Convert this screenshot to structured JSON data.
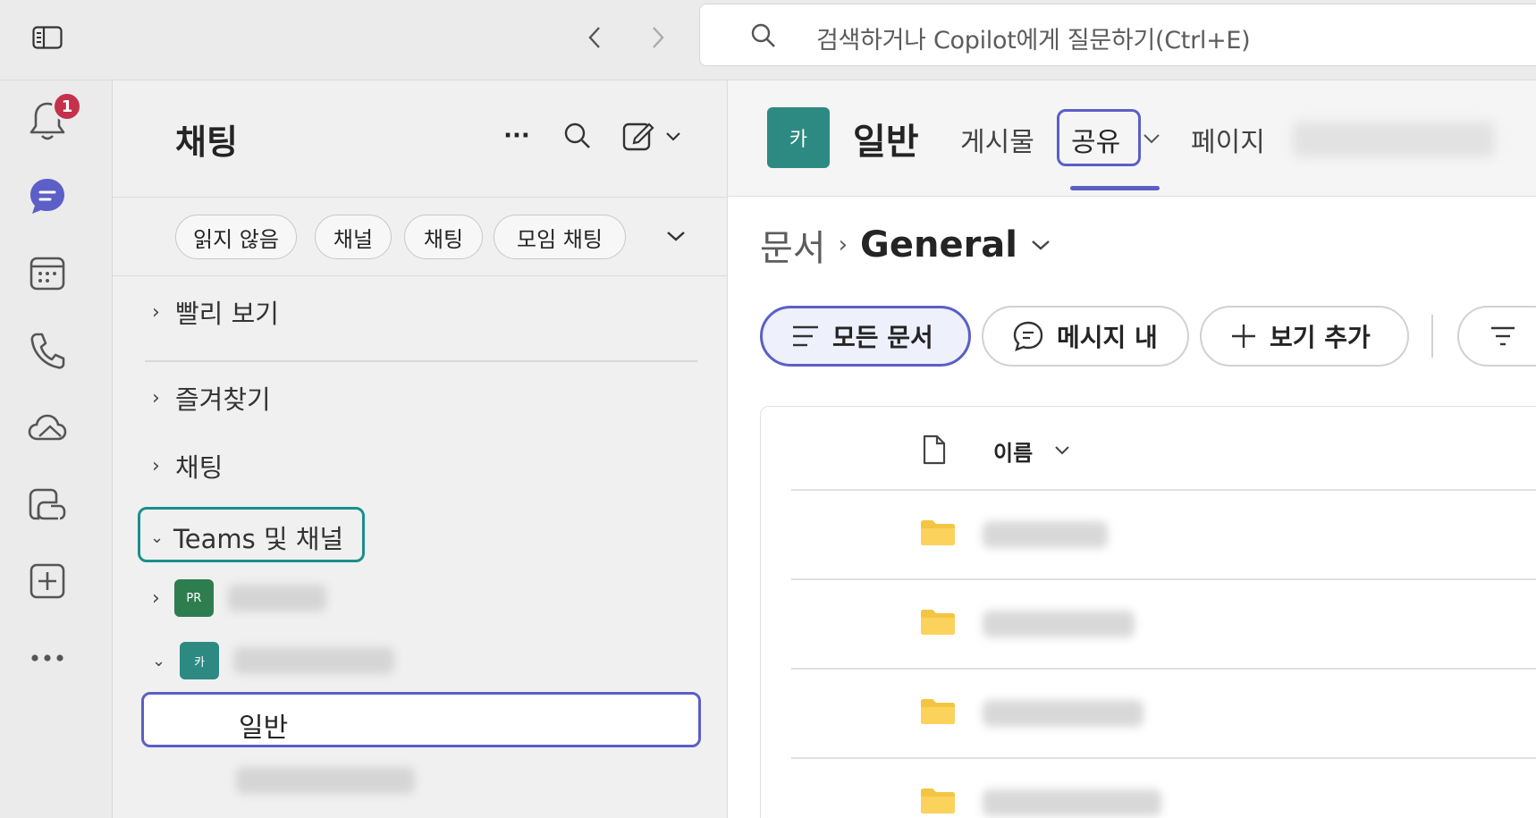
{
  "titlebar": {
    "search_placeholder": "검색하거나 Copilot에게 질문하기(Ctrl+E)"
  },
  "rail": {
    "notification_count": "1"
  },
  "chat_pane": {
    "title": "채팅",
    "more_label": "···",
    "filters": [
      "읽지 않음",
      "채널",
      "채팅",
      "모임 채팅"
    ],
    "sections": {
      "quick_view": "빨리 보기",
      "favorites": "즐겨찾기",
      "chats": "채팅",
      "teams": "Teams 및 채널"
    },
    "teams": [
      {
        "avatar": "PR",
        "color": "#2e7d4f"
      },
      {
        "avatar": "카",
        "color": "#2d8a82"
      }
    ],
    "selected_channel": "일반"
  },
  "main": {
    "channel_avatar": "카",
    "channel_name": "일반",
    "tabs": [
      "게시물",
      "공유",
      "페이지"
    ],
    "breadcrumb": {
      "root": "문서",
      "current": "General"
    },
    "view_buttons": [
      "모든 문서",
      "메시지 내",
      "보기 추가"
    ],
    "column_name": "이름"
  },
  "colors": {
    "accent": "#5b5fc7",
    "teal": "#1a8f8c",
    "badge": "#c4314b",
    "folder": "#f4c542"
  }
}
